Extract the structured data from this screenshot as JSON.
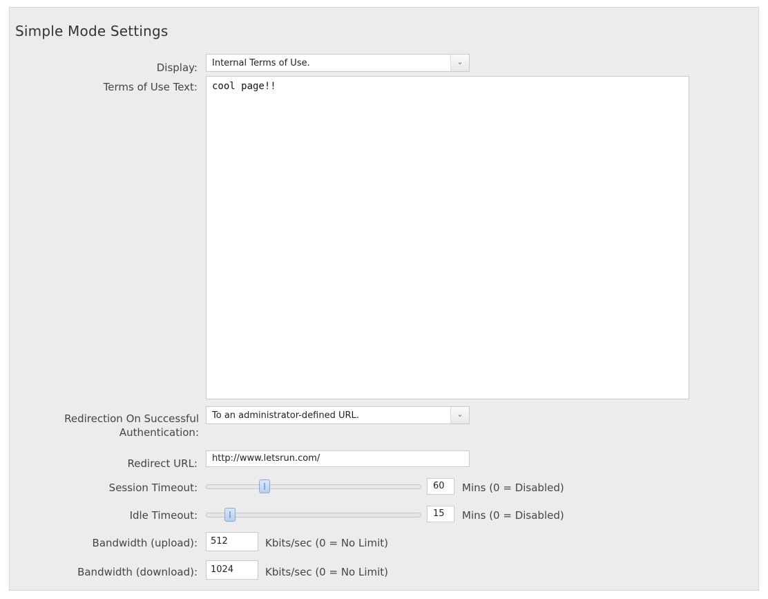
{
  "section_title": "Simple Mode Settings",
  "display": {
    "label": "Display:",
    "value": "Internal Terms of Use."
  },
  "terms": {
    "label": "Terms of Use Text:",
    "value": "cool page!!"
  },
  "redirection": {
    "label_line1": "Redirection On Successful",
    "label_line2": "Authentication:",
    "value": "To an administrator-defined URL."
  },
  "redirect_url": {
    "label": "Redirect URL:",
    "value": "http://www.letsrun.com/"
  },
  "session_timeout": {
    "label": "Session Timeout:",
    "value": "60",
    "unit": "Mins (0 = Disabled)",
    "slider_fraction": 0.26
  },
  "idle_timeout": {
    "label": "Idle Timeout:",
    "value": "15",
    "unit": "Mins (0 = Disabled)",
    "slider_fraction": 0.09
  },
  "bandwidth_upload": {
    "label": "Bandwidth (upload):",
    "value": "512",
    "unit": "Kbits/sec (0 = No Limit)"
  },
  "bandwidth_download": {
    "label": "Bandwidth (download):",
    "value": "1024",
    "unit": "Kbits/sec (0 = No Limit)"
  },
  "icons": {
    "dropdown": "chevron-down-icon",
    "slider": "slider-thumb"
  }
}
